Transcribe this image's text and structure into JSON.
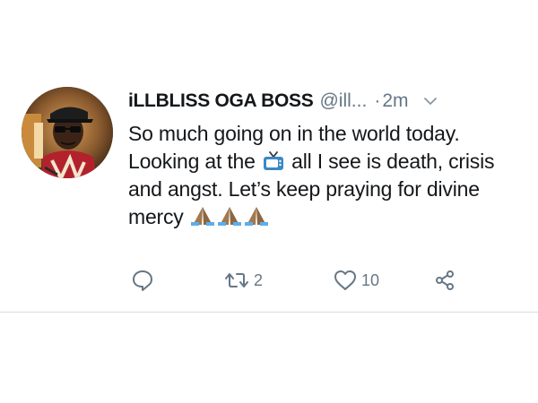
{
  "tweet": {
    "display_name": "iLLBLISS OGA BOSS",
    "handle": "@ill...",
    "separator": "·",
    "time": "2m",
    "text_part1": "So much going on in the world today. Looking at the",
    "text_part2": "all I see is death, crisis and angst. Let’s keep praying for divine mercy",
    "inline_icons": [
      "television-icon",
      "praying-hands-icon",
      "praying-hands-icon",
      "praying-hands-icon"
    ]
  },
  "actions": {
    "reply_count": "",
    "retweet_count": "2",
    "like_count": "10"
  },
  "colors": {
    "text": "#14171a",
    "secondary": "#657786",
    "tv_blue": "#3b88c3",
    "divider": "#d6dbdf"
  }
}
